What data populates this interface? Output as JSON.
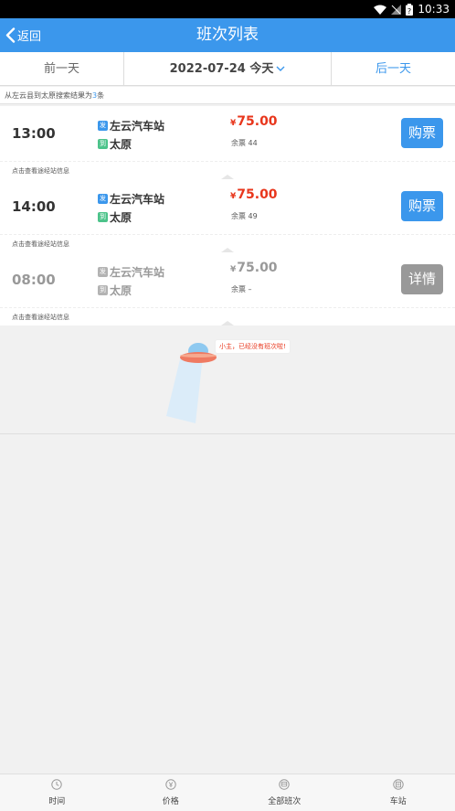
{
  "status_bar": {
    "time": "10:33"
  },
  "header": {
    "back_label": "返回",
    "title": "班次列表"
  },
  "date_nav": {
    "prev_label": "前一天",
    "date": "2022-07-24",
    "today": "今天",
    "next_label": "后一天"
  },
  "summary": {
    "prefix": "从左云县到太原搜索结果为",
    "count": "3",
    "suffix": "条"
  },
  "trips": [
    {
      "time": "13:00",
      "origin_tag": "发",
      "origin": "左云汽车站",
      "dest_tag": "到",
      "dest": "太原",
      "currency": "¥",
      "price": "75.00",
      "remaining": "余票 44",
      "action": "购票",
      "route_info": "点击查看途经站信息"
    },
    {
      "time": "14:00",
      "origin_tag": "发",
      "origin": "左云汽车站",
      "dest_tag": "到",
      "dest": "太原",
      "currency": "¥",
      "price": "75.00",
      "remaining": "余票 49",
      "action": "购票",
      "route_info": "点击查看途经站信息"
    },
    {
      "time": "08:00",
      "origin_tag": "发",
      "origin": "左云汽车站",
      "dest_tag": "到",
      "dest": "太原",
      "currency": "¥",
      "price": "75.00",
      "remaining": "余票 –",
      "action": "详情",
      "route_info": "点击查看途经站信息"
    }
  ],
  "empty_message": "小主，已经没有班次啦!",
  "tabs": [
    {
      "label": "时间",
      "icon": "clock-icon"
    },
    {
      "label": "价格",
      "icon": "yen-icon"
    },
    {
      "label": "全部班次",
      "icon": "bus-icon"
    },
    {
      "label": "车站",
      "icon": "station-icon"
    }
  ],
  "colors": {
    "primary": "#3b97ec",
    "price": "#e8361c",
    "disabled": "#999999",
    "dest_tag": "#4cc38a"
  }
}
